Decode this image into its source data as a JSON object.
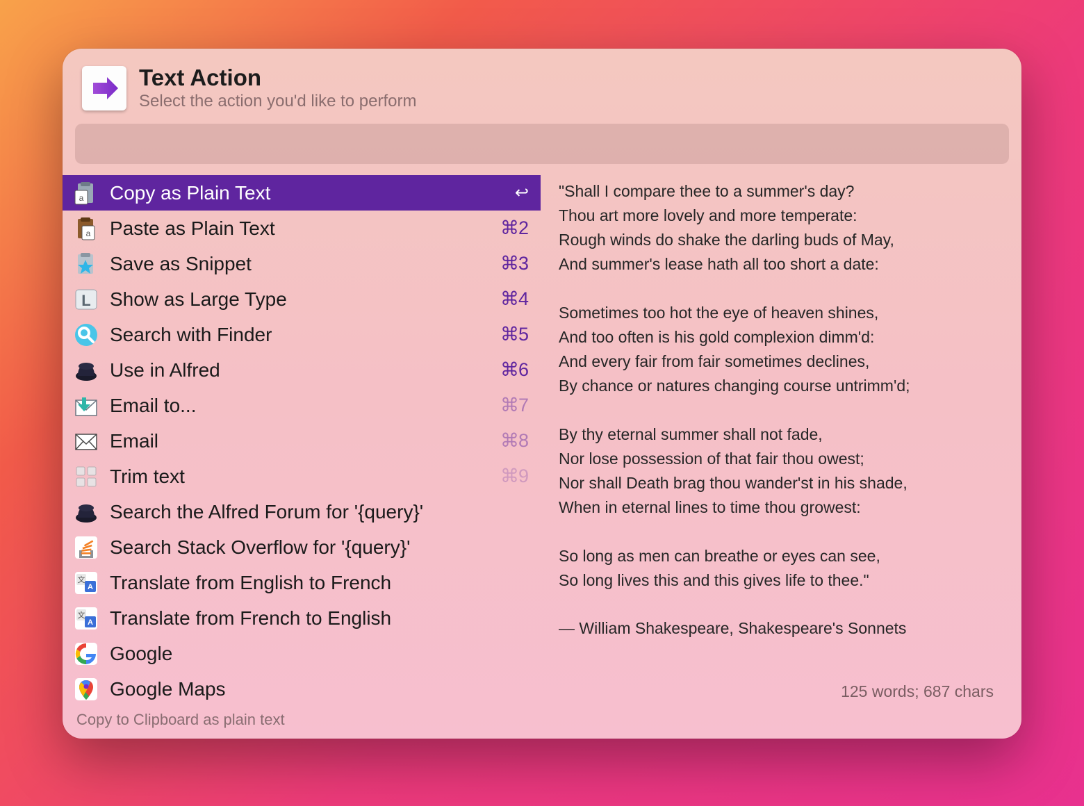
{
  "header": {
    "title": "Text Action",
    "subtitle": "Select the action you'd like to perform"
  },
  "search": {
    "placeholder": "",
    "value": ""
  },
  "actions": [
    {
      "label": "Copy as Plain Text",
      "shortcut": "↩",
      "selected": true,
      "icon": "clipboard-copy-icon"
    },
    {
      "label": "Paste as Plain Text",
      "shortcut": "⌘2",
      "icon": "clipboard-paste-icon"
    },
    {
      "label": "Save as Snippet",
      "shortcut": "⌘3",
      "icon": "snippet-icon"
    },
    {
      "label": "Show as Large Type",
      "shortcut": "⌘4",
      "icon": "large-type-icon"
    },
    {
      "label": "Search with Finder",
      "shortcut": "⌘5",
      "icon": "finder-search-icon"
    },
    {
      "label": "Use in Alfred",
      "shortcut": "⌘6",
      "icon": "alfred-icon"
    },
    {
      "label": "Email to...",
      "shortcut": "⌘7",
      "icon": "email-to-icon",
      "dim": true
    },
    {
      "label": "Email",
      "shortcut": "⌘8",
      "icon": "email-icon",
      "dim": true
    },
    {
      "label": "Trim text",
      "shortcut": "⌘9",
      "icon": "trim-icon",
      "very_dim": true
    },
    {
      "label": "Search the Alfred Forum for '{query}'",
      "shortcut": "",
      "icon": "alfred-icon"
    },
    {
      "label": "Search Stack Overflow for '{query}'",
      "shortcut": "",
      "icon": "stackoverflow-icon"
    },
    {
      "label": "Translate from English to French",
      "shortcut": "",
      "icon": "translate-icon"
    },
    {
      "label": "Translate from French to English",
      "shortcut": "",
      "icon": "translate-icon"
    },
    {
      "label": "Google",
      "shortcut": "",
      "icon": "google-icon"
    },
    {
      "label": "Google Maps",
      "shortcut": "",
      "icon": "google-maps-icon"
    }
  ],
  "preview": {
    "text": "\"Shall I compare thee to a summer's day?\nThou art more lovely and more temperate:\nRough winds do shake the darling buds of May,\nAnd summer's lease hath all too short a date:\n\nSometimes too hot the eye of heaven shines,\nAnd too often is his gold complexion dimm'd:\nAnd every fair from fair sometimes declines,\nBy chance or natures changing course untrimm'd;\n\nBy thy eternal summer shall not fade,\nNor lose possession of that fair thou owest;\nNor shall Death brag thou wander'st in his shade,\nWhen in eternal lines to time thou growest:\n\nSo long as men can breathe or eyes can see,\nSo long lives this and this gives life to thee.\"\n\n― William Shakespeare, Shakespeare's Sonnets",
    "stats": "125 words; 687 chars"
  },
  "footer": {
    "hint": "Copy to Clipboard as plain text"
  },
  "colors": {
    "selection": "#5f259f",
    "shortcut": "#5f259f"
  }
}
